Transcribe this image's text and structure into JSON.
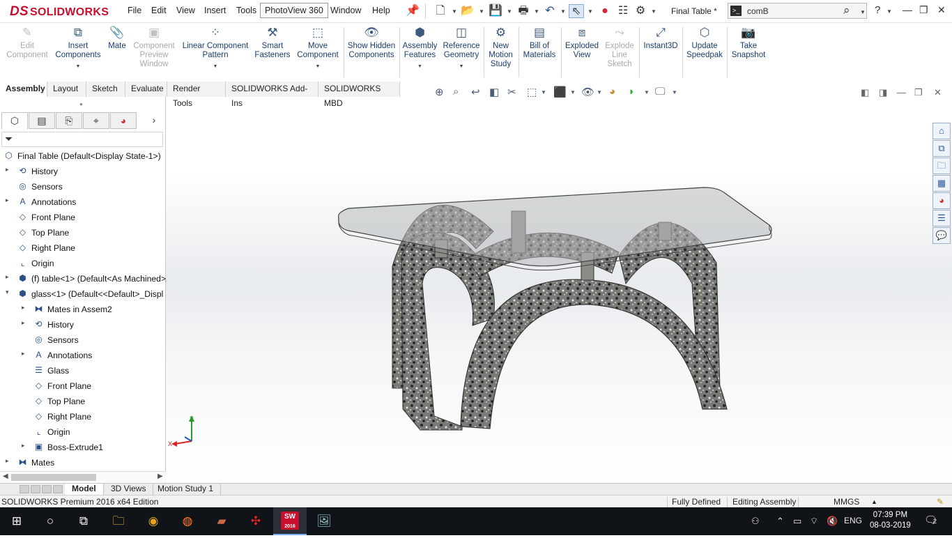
{
  "app": {
    "logo_ds": "DS",
    "logo_name": "SOLIDWORKS"
  },
  "menu": [
    "File",
    "Edit",
    "View",
    "Insert",
    "Tools",
    "PhotoView 360",
    "Window",
    "Help"
  ],
  "document_title": "Final Table *",
  "command_search": {
    "value": "comB"
  },
  "command_manager": [
    {
      "label": "Edit Component",
      "icon": "edit-component-icon",
      "disabled": true
    },
    {
      "label": "Insert Components",
      "icon": "insert-components-icon",
      "disabled": false
    },
    {
      "label": "Mate",
      "icon": "mate-icon",
      "disabled": false
    },
    {
      "label": "Component Preview Window",
      "icon": "component-preview-icon",
      "disabled": true
    },
    {
      "label": "Linear Component Pattern",
      "icon": "linear-pattern-icon",
      "disabled": false
    },
    {
      "label": "Smart Fasteners",
      "icon": "smart-fasteners-icon",
      "disabled": false
    },
    {
      "label": "Move Component",
      "icon": "move-component-icon",
      "disabled": false
    },
    {
      "label": "Show Hidden Components",
      "icon": "show-hidden-icon",
      "disabled": false
    },
    {
      "label": "Assembly Features",
      "icon": "assembly-features-icon",
      "disabled": false
    },
    {
      "label": "Reference Geometry",
      "icon": "reference-geometry-icon",
      "disabled": false
    },
    {
      "label": "New Motion Study",
      "icon": "motion-study-icon",
      "disabled": false
    },
    {
      "label": "Bill of Materials",
      "icon": "bill-of-materials-icon",
      "disabled": false
    },
    {
      "label": "Exploded View",
      "icon": "exploded-view-icon",
      "disabled": false
    },
    {
      "label": "Explode Line Sketch",
      "icon": "explode-line-icon",
      "disabled": true
    },
    {
      "label": "Instant3D",
      "icon": "instant3d-icon",
      "disabled": false
    },
    {
      "label": "Update Speedpak",
      "icon": "speedpak-icon",
      "disabled": false
    },
    {
      "label": "Take Snapshot",
      "icon": "snapshot-icon",
      "disabled": false
    }
  ],
  "tabs": [
    "Assembly",
    "Layout",
    "Sketch",
    "Evaluate",
    "Render Tools",
    "SOLIDWORKS Add-Ins",
    "SOLIDWORKS MBD"
  ],
  "feature_tree": [
    {
      "label": "Final Table  (Default<Display State-1>)",
      "icon": "assembly-icon",
      "level": 0,
      "expand": ""
    },
    {
      "label": "History",
      "icon": "history-icon",
      "level": 1,
      "expand": "▸"
    },
    {
      "label": "Sensors",
      "icon": "sensors-icon",
      "level": 1,
      "expand": ""
    },
    {
      "label": "Annotations",
      "icon": "annotations-icon",
      "level": 1,
      "expand": "▸"
    },
    {
      "label": "Front Plane",
      "icon": "plane-icon",
      "level": 1,
      "expand": ""
    },
    {
      "label": "Top Plane",
      "icon": "plane-icon",
      "level": 1,
      "expand": ""
    },
    {
      "label": "Right Plane",
      "icon": "plane-icon",
      "level": 1,
      "expand": ""
    },
    {
      "label": "Origin",
      "icon": "origin-icon",
      "level": 1,
      "expand": ""
    },
    {
      "label": "(f) table<1> (Default<As Machined>",
      "icon": "part-icon",
      "level": 1,
      "expand": "▸"
    },
    {
      "label": "glass<1> (Default<<Default>_Displ",
      "icon": "part-icon",
      "level": 1,
      "expand": "▾"
    },
    {
      "label": "Mates in Assem2",
      "icon": "mates-icon",
      "level": 2,
      "expand": "▸"
    },
    {
      "label": "History",
      "icon": "history-icon",
      "level": 2,
      "expand": "▸"
    },
    {
      "label": "Sensors",
      "icon": "sensors-icon",
      "level": 2,
      "expand": ""
    },
    {
      "label": "Annotations",
      "icon": "annotations-icon",
      "level": 2,
      "expand": "▸"
    },
    {
      "label": "Glass",
      "icon": "material-icon",
      "level": 2,
      "expand": ""
    },
    {
      "label": "Front Plane",
      "icon": "plane-icon",
      "level": 2,
      "expand": ""
    },
    {
      "label": "Top Plane",
      "icon": "plane-icon",
      "level": 2,
      "expand": ""
    },
    {
      "label": "Right Plane",
      "icon": "plane-icon",
      "level": 2,
      "expand": ""
    },
    {
      "label": "Origin",
      "icon": "origin-icon",
      "level": 2,
      "expand": ""
    },
    {
      "label": "Boss-Extrude1",
      "icon": "extrude-icon",
      "level": 2,
      "expand": "▸"
    },
    {
      "label": "Mates",
      "icon": "mates-icon",
      "level": 1,
      "expand": "▸"
    }
  ],
  "triad": {
    "y": "Y",
    "x": "X"
  },
  "bottom_tabs": [
    "Model",
    "3D Views",
    "Motion Study 1"
  ],
  "status": {
    "edition": "SOLIDWORKS Premium 2016 x64 Edition",
    "state": "Fully Defined",
    "mode": "Editing Assembly",
    "units": "MMGS"
  },
  "taskbar": {
    "lang": "ENG",
    "time": "07:39 PM",
    "date": "08-03-2019",
    "notifications": "2",
    "sw_badge": "SW",
    "sw_year": "2016"
  },
  "colors": {
    "brand": "#c8102e",
    "accent": "#1a3d6e",
    "taskbar": "#101318"
  }
}
